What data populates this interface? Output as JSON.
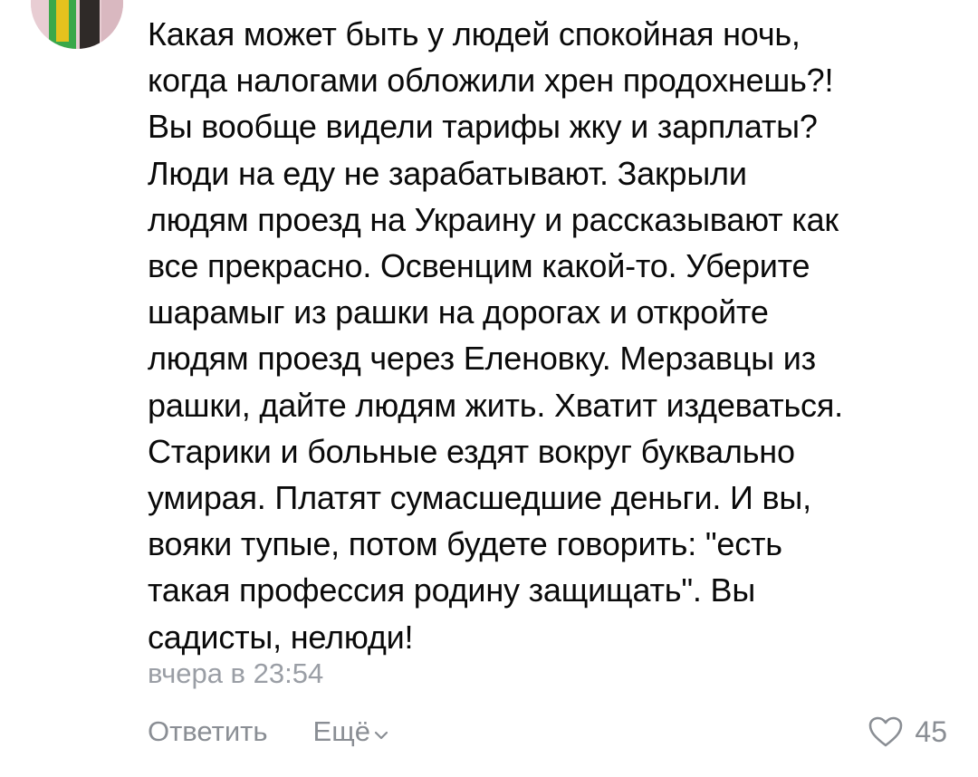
{
  "comment": {
    "lines": [
      "Какая может быть у людей спокойная ночь,",
      "когда налогами обложили хрен продохнешь?!",
      "Вы вообще видели тарифы жку и зарплаты?",
      "Люди на еду не зарабатывают. Закрыли",
      "людям проезд на Украину и рассказывают как",
      "все прекрасно. Освенцим какой-то. Уберите",
      "шарамыг из рашки на дорогах и откройте",
      "людям проезд через Еленовку. Мерзавцы из",
      "рашки, дайте людям жить. Хватит издеваться.",
      "Старики и больные ездят вокруг буквально",
      "умирая. Платят сумасшедшие деньги. И вы,",
      "вояки тупые, потом будете говорить: \"есть",
      "такая профессия родину защищать\". Вы",
      "садисты, нелюди!"
    ],
    "timestamp": "вчера в 23:54"
  },
  "actions": {
    "reply_label": "Ответить",
    "more_label": "Ещё",
    "likes_count": "45"
  },
  "colors": {
    "text": "#0a0a0a",
    "meta": "#9a9ea5",
    "action": "#8a8e94"
  },
  "icons": {
    "more_chevron": "chevron-down-icon",
    "like": "heart-outline-icon"
  }
}
